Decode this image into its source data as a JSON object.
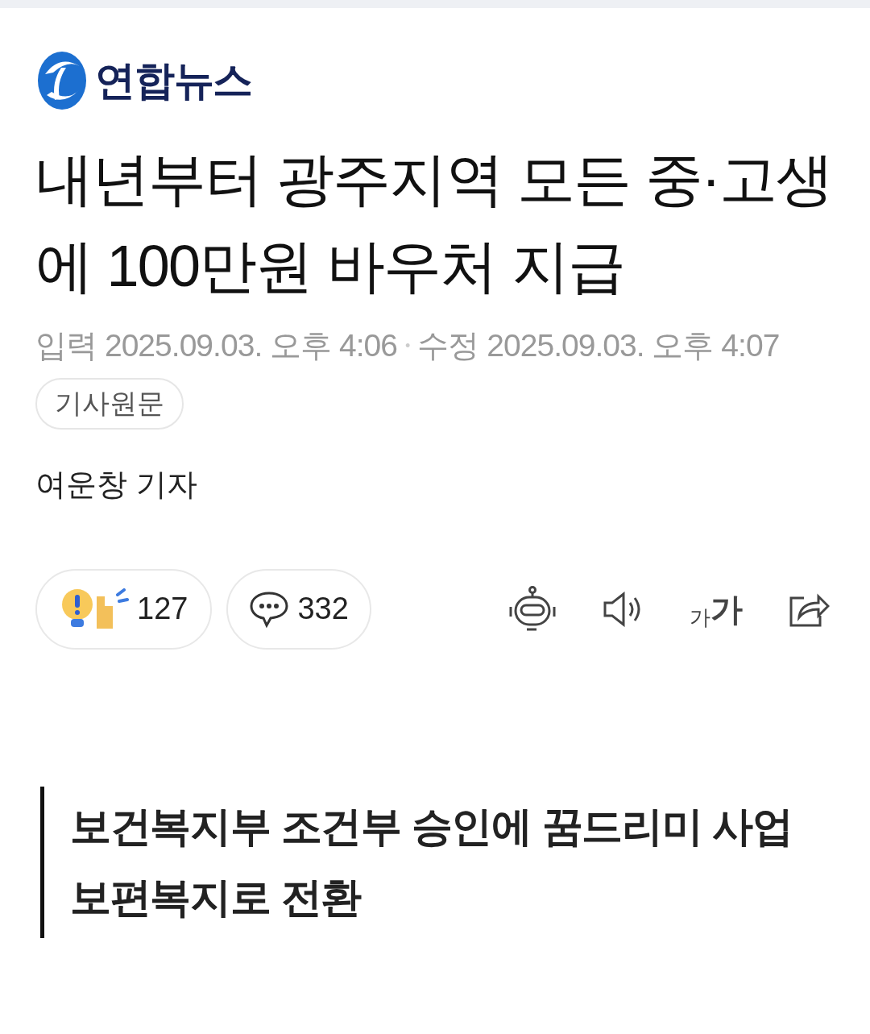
{
  "brand": {
    "name": "연합뉴스"
  },
  "headline": "내년부터 광주지역 모든 중·고생에 100만원 바우처 지급",
  "meta": {
    "published_label": "입력",
    "published": "2025.09.03. 오후 4:06",
    "separator": "•",
    "modified_label": "수정",
    "modified": "2025.09.03. 오후 4:07"
  },
  "original_link": "기사원문",
  "byline": "여운창 기자",
  "actions": {
    "reactions": "127",
    "comments": "332",
    "font_size": [
      "가",
      "가"
    ]
  },
  "subheading": "보건복지부 조건부 승인에 꿈드리미 사업 보편복지로 전환"
}
